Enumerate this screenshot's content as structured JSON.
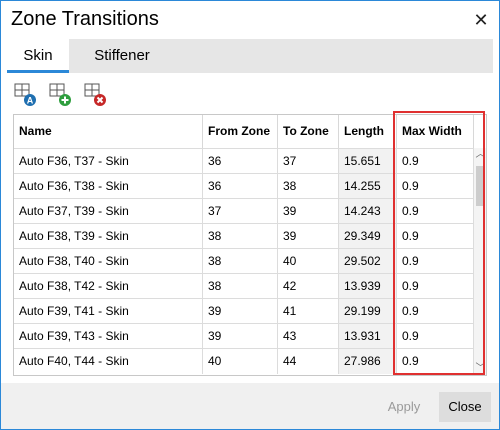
{
  "window": {
    "title": "Zone Transitions"
  },
  "tabs": [
    {
      "label": "Skin"
    },
    {
      "label": "Stiffener"
    }
  ],
  "toolbar": {
    "icons": [
      "add-zone-icon",
      "add-transition-icon",
      "delete-transition-icon"
    ]
  },
  "table": {
    "columns": [
      "Name",
      "From Zone",
      "To Zone",
      "Length",
      "Max Width"
    ],
    "rows": [
      [
        "Auto F36, T37 - Skin",
        "36",
        "37",
        "15.651",
        "0.9"
      ],
      [
        "Auto F36, T38 - Skin",
        "36",
        "38",
        "14.255",
        "0.9"
      ],
      [
        "Auto F37, T39 - Skin",
        "37",
        "39",
        "14.243",
        "0.9"
      ],
      [
        "Auto F38, T39 - Skin",
        "38",
        "39",
        "29.349",
        "0.9"
      ],
      [
        "Auto F38, T40 - Skin",
        "38",
        "40",
        "29.502",
        "0.9"
      ],
      [
        "Auto F38, T42 - Skin",
        "38",
        "42",
        "13.939",
        "0.9"
      ],
      [
        "Auto F39, T41 - Skin",
        "39",
        "41",
        "29.199",
        "0.9"
      ],
      [
        "Auto F39, T43 - Skin",
        "39",
        "43",
        "13.931",
        "0.9"
      ],
      [
        "Auto F40, T44 - Skin",
        "40",
        "44",
        "27.986",
        "0.9"
      ]
    ]
  },
  "buttons": {
    "apply": "Apply",
    "close": "Close"
  },
  "colors": {
    "accent": "#2b88d8",
    "highlight": "#e03030"
  }
}
